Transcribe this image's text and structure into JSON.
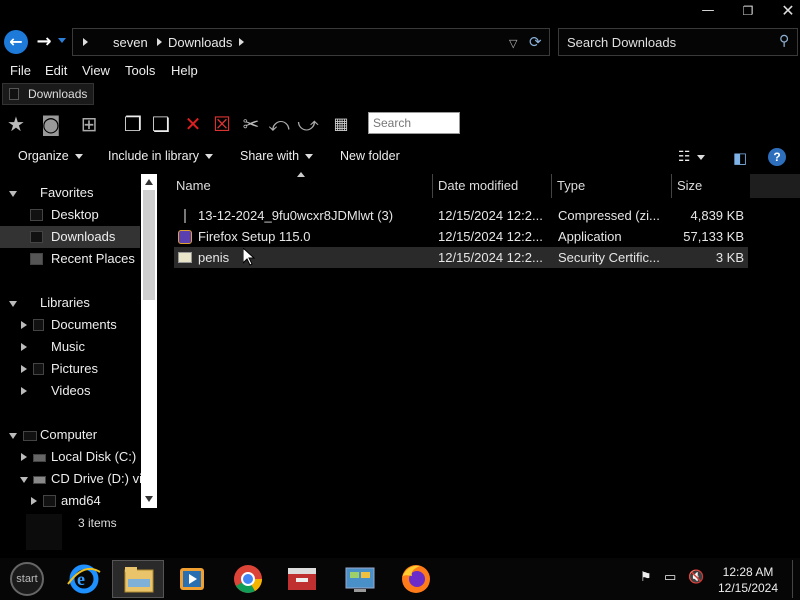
{
  "window": {
    "minimize_glyph": "—",
    "maximize_glyph": "❐",
    "close_glyph": "✕"
  },
  "address_bar": {
    "breadcrumbs": [
      "seven",
      "Downloads"
    ],
    "search_placeholder": "Search Downloads"
  },
  "menu": [
    "File",
    "Edit",
    "View",
    "Tools",
    "Help"
  ],
  "tab": {
    "label": "Downloads"
  },
  "toolbar_icons": [
    "star-icon",
    "camera-icon",
    "windows-flag-icon",
    "copy-icon",
    "move-icon",
    "delete-icon",
    "clear-icon",
    "cut-icon",
    "undo-icon",
    "redo-icon",
    "view-mode-icon"
  ],
  "toolbar_search_placeholder": "Search",
  "commands": {
    "organize": "Organize",
    "include": "Include in library",
    "share": "Share with",
    "new_folder": "New folder"
  },
  "nav": {
    "favorites": "Favorites",
    "desktop": "Desktop",
    "downloads": "Downloads",
    "recent": "Recent Places",
    "libraries": "Libraries",
    "documents": "Documents",
    "music": "Music",
    "pictures": "Pictures",
    "videos": "Videos",
    "computer": "Computer",
    "local_disk": "Local Disk (C:)",
    "cd_drive": "CD Drive (D:) vi",
    "amd64": "amd64"
  },
  "columns": {
    "name": "Name",
    "date": "Date modified",
    "type": "Type",
    "size": "Size"
  },
  "files": [
    {
      "name": "13-12-2024_9fu0wcxr8JDMlwt (3)",
      "date": "12/15/2024 12:2...",
      "type": "Compressed (zi...",
      "size": "4,839 KB",
      "icon": "zip-icon"
    },
    {
      "name": "Firefox Setup 115.0",
      "date": "12/15/2024 12:2...",
      "type": "Application",
      "size": "57,133 KB",
      "icon": "installer-icon"
    },
    {
      "name": "penis",
      "date": "12/15/2024 12:2...",
      "type": "Security Certific...",
      "size": "3 KB",
      "icon": "certificate-icon"
    }
  ],
  "status": {
    "items": "3 items"
  },
  "taskbar": {
    "start_label": "start",
    "apps": [
      "internet-explorer",
      "file-explorer",
      "media-player",
      "chrome",
      "toolbox",
      "control-panel",
      "firefox"
    ],
    "clock_time": "12:28 AM",
    "clock_date": "12/15/2024"
  }
}
